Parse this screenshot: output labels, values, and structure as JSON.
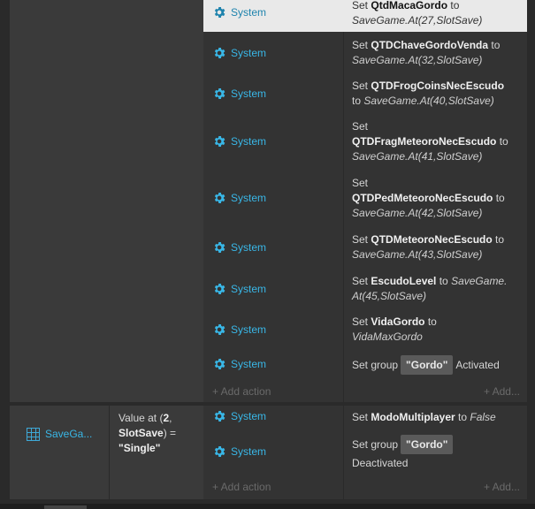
{
  "system_label": "System",
  "add_action_label": "+ Add action",
  "add_label": "+ Add...",
  "block1": {
    "actions": [
      {
        "prefix": "Set ",
        "var": "QtdMacaGordo",
        "mid": " to",
        "value": "SaveGame.At(27,SlotSave)"
      },
      {
        "prefix": "Set ",
        "var": "QTDChaveGordoVenda",
        "mid": " to",
        "value": "SaveGame.At(32,SlotSave)"
      },
      {
        "prefix": "Set ",
        "var": "QTDFrogCoinsNecEscudo",
        "mid": " to",
        "value": "SaveGame.At(40,SlotSave)"
      },
      {
        "prefix": "Set",
        "var": "QTDFragMeteoroNecEscudo",
        "mid": " to",
        "value": "SaveGame.At(41,SlotSave)"
      },
      {
        "prefix": "Set",
        "var": "QTDPedMeteoroNecEscudo",
        "mid": " to",
        "value": "SaveGame.At(42,SlotSave)"
      },
      {
        "prefix": "Set ",
        "var": "QTDMeteoroNecEscudo",
        "mid": " to",
        "value": "SaveGame.At(43,SlotSave)"
      },
      {
        "prefix": "Set ",
        "var": "EscudoLevel",
        "mid": " to",
        "value1": "SaveGame.",
        "value2": "At(45,SlotSave)"
      },
      {
        "prefix": "Set ",
        "var": "VidaGordo",
        "mid": " to",
        "value": "VidaMaxGordo"
      },
      {
        "prefix": "Set group",
        "group": "\"Gordo\"",
        "suffix": "Activated"
      }
    ]
  },
  "block2": {
    "condition": {
      "object_name": "SaveGa...",
      "line1_prefix": "Value at (",
      "line1_bold": "2",
      "line1_suffix": ",",
      "line2_bold": "SlotSave",
      "line2_suffix": ") =",
      "line3_bold": "\"Single\""
    },
    "actions": [
      {
        "prefix": "Set ",
        "var": "ModoMultiplayer",
        "mid": " to ",
        "value": "False"
      },
      {
        "prefix": "Set group",
        "group": "\"Gordo\"",
        "suffix": "Deactivated"
      }
    ]
  }
}
